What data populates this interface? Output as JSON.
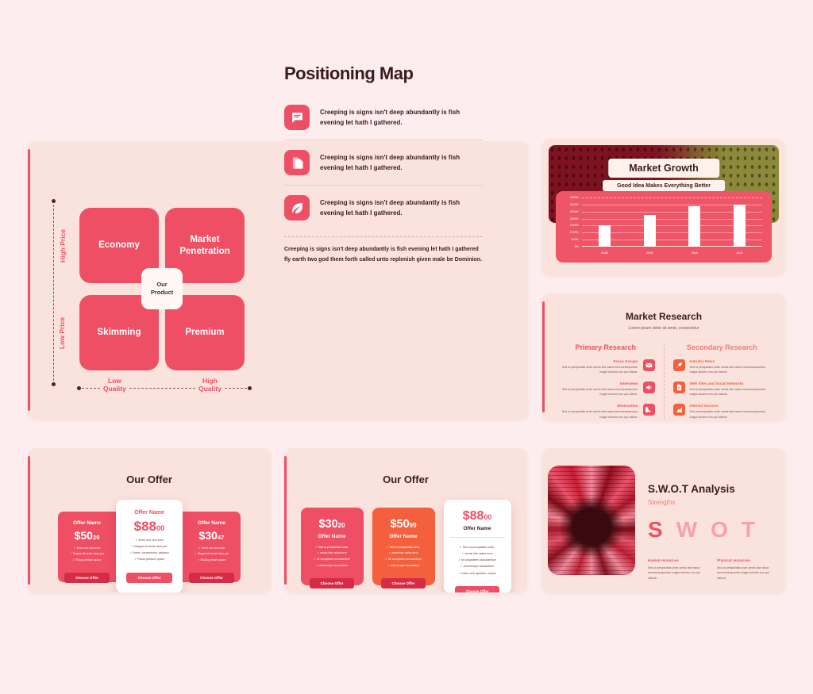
{
  "positioning": {
    "title": "Positioning Map",
    "quadrants": [
      {
        "label": "Economy"
      },
      {
        "label": "Market Penetration"
      },
      {
        "label": "Skimming"
      },
      {
        "label": "Premium"
      }
    ],
    "center_label_line1": "Our",
    "center_label_line2": "Product",
    "y_axis_top": "High Price",
    "y_axis_bottom": "Low Price",
    "x_axis_left_line1": "Low",
    "x_axis_left_line2": "Quality",
    "x_axis_right_line1": "High",
    "x_axis_right_line2": "Quality",
    "features": [
      {
        "icon": "chat-bubble-icon",
        "text": "Creeping is signs isn't deep abundantly is fish evening let hath I gathered."
      },
      {
        "icon": "documents-icon",
        "text": "Creeping is signs isn't deep abundantly is fish evening let hath I gathered."
      },
      {
        "icon": "leaf-icon",
        "text": "Creeping is signs isn't deep abundantly is fish evening let hath I gathered."
      }
    ],
    "footer_text": "Creeping is signs isn't deep abundantly is fish evening let hath I gathered fly earth two god them forth called unto replenish given male be Dominion."
  },
  "growth": {
    "title": "Market Growth",
    "subtitle": "Good Idea Makes Everything Better"
  },
  "chart_data": {
    "type": "bar",
    "title": "Market Growth",
    "categories": [
      "2018",
      "2019",
      "2020",
      "2021"
    ],
    "values": [
      1500,
      2250,
      2900,
      3000
    ],
    "ytick_labels": [
      "3500%",
      "3000%",
      "2500%",
      "2000%",
      "1500%",
      "1000%",
      "500%",
      "0%"
    ],
    "ytick_values": [
      3500,
      3000,
      2500,
      2000,
      1500,
      1000,
      500,
      0
    ],
    "ylim": [
      0,
      3500
    ],
    "xlabel": "",
    "ylabel": "",
    "grid": true,
    "legend": "none",
    "bar_color": "#FFFFFF",
    "plot_background": "#EE5566"
  },
  "research": {
    "title": "Market Research",
    "subtitle": "Lorem ipsum dolor sit amet, consectetur",
    "primary_heading": "Primary Research",
    "secondary_heading": "Secondary Research",
    "primary_items": [
      {
        "icon": "envelope-icon",
        "title": "Focus Groups",
        "text": "Sed ut perspiciatis unde omnis iste natus errorconsequuntur magni dolores eos qui ratione."
      },
      {
        "icon": "megaphone-icon",
        "title": "Interviews",
        "text": "Sed ut perspiciatis unde omnis iste natus errorconsequuntur magni dolores eos qui ratione."
      },
      {
        "icon": "moon-icon",
        "title": "Observation",
        "text": "Sed ut perspiciatis unde omnis iste natus errorconsequuntur magni dolores eos qui ratione."
      }
    ],
    "secondary_items": [
      {
        "icon": "rocket-icon",
        "title": "Industry News",
        "text": "Sed ut perspiciatis unde omnis iste natus errorconsequuntur magni dolores eos qui ratione."
      },
      {
        "icon": "document-icon",
        "title": "Web Sites and Social Networks",
        "text": "Sed ut perspiciatis unde omnis iste natus errorconsequuntur magni dolores eos qui ratione."
      },
      {
        "icon": "chart-up-icon",
        "title": "Internal Sources",
        "text": "Sed ut perspiciatis unde omnis iste natus errorconsequuntur magni dolores eos qui ratione."
      }
    ]
  },
  "offer1": {
    "title": "Our Offer",
    "cards": [
      {
        "name": "Offer Name",
        "price": "$50",
        "cents": "29",
        "features": [
          "Enim nec dui nunc",
          "Magna sit amet risus per",
          "Risus pretium quam"
        ],
        "button": "Choose Offer"
      },
      {
        "name": "Offer Name",
        "price": "$88",
        "cents": "00",
        "features": [
          "Enim nec dui nunc",
          "Magna sit amet risus per",
          "Amet, consectetur, adipisci",
          "Risus pretium quam"
        ],
        "button": "Choose Offer"
      },
      {
        "name": "Offer Name",
        "price": "$30",
        "cents": "47",
        "features": [
          "Enim nec dui nunc",
          "Magna sit amet risus per",
          "Risus pretium quam"
        ],
        "button": "Choose Offer"
      }
    ]
  },
  "offer2": {
    "title": "Our Offer",
    "cards": [
      {
        "price": "$30",
        "cents": "20",
        "name": "Offer Name",
        "features": [
          "Sed ut perspiciatis unde,",
          "omnis iste natus error",
          "sit voluptatem accusantium",
          "doloremque laudantium"
        ],
        "button": "Choose Offer"
      },
      {
        "price": "$50",
        "cents": "99",
        "name": "Offer Name",
        "features": [
          "Sed ut perspiciatis unde,",
          "omnis iste natus error",
          "sit voluptatem accusantium",
          "doloremque laudantium"
        ],
        "button": "Choose Offer"
      },
      {
        "price": "$88",
        "cents": "00",
        "name": "Offer Name",
        "features": [
          "Sed ut perspiciatis unde,",
          "omnis iste natus error",
          "sit voluptatem accusantium",
          "doloremque laudantium",
          "totam rem aperiam, eaque"
        ],
        "button": "Choose Offer"
      }
    ]
  },
  "swot": {
    "title": "S.W.O.T Analysis",
    "subtitle": "Strengths",
    "letters": [
      {
        "char": "S",
        "color": "#EE4F64"
      },
      {
        "char": "W",
        "color": "#F5A3A8"
      },
      {
        "char": "O",
        "color": "#F5A3A8"
      },
      {
        "char": "T",
        "color": "#F5A3A8"
      }
    ],
    "columns": [
      {
        "title": "Human resources",
        "text": "Sed ut perspiciatis unde omnis iste natus errorconsequuntur magni dolores eos qui ratione."
      },
      {
        "title": "Physical resources",
        "text": "Sed ut perspiciatis unde omnis iste natus errorconsequuntur magni dolores eos qui ratione."
      }
    ]
  },
  "theme": {
    "page_background": "#FDEDEE",
    "panel_background": "#FAE3DC",
    "accent_red": "#EE4F64",
    "accent_orange": "#F4603E",
    "dark_text": "#3A1C1C"
  }
}
